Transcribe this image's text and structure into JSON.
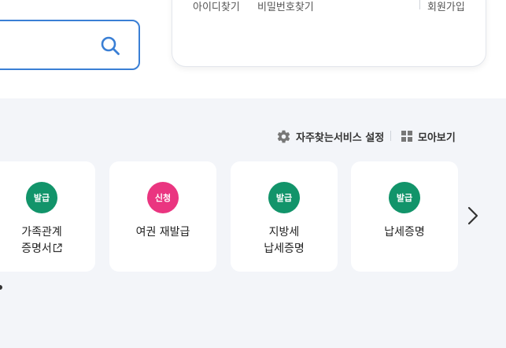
{
  "login": {
    "find_id": "아이디찾기",
    "find_password": "비밀번호찾기",
    "signup": "회원가입"
  },
  "toolbar": {
    "settings_label": "자주찾는서비스 설정",
    "view_all_label": "모아보기"
  },
  "services": [
    {
      "badge": "발급",
      "badge_color": "#12946a",
      "line1": "가족관계",
      "line2": "증명서"
    },
    {
      "badge": "신청",
      "badge_color": "#ea3580",
      "line1": "여권 재발급",
      "line2": ""
    },
    {
      "badge": "발급",
      "badge_color": "#12946a",
      "line1": "지방세",
      "line2": "납세증명"
    },
    {
      "badge": "발급",
      "badge_color": "#12946a",
      "line1": "납세증명",
      "line2": ""
    }
  ],
  "colors": {
    "accent_blue": "#3a7fd5",
    "badge_green": "#12946a",
    "badge_pink": "#ea3580",
    "section_bg": "#f3f5f9"
  },
  "icons": {
    "search": "search-icon",
    "settings": "gear-icon",
    "view_all": "grid-icon",
    "external": "external-link-icon",
    "next": "chevron-right-icon"
  }
}
